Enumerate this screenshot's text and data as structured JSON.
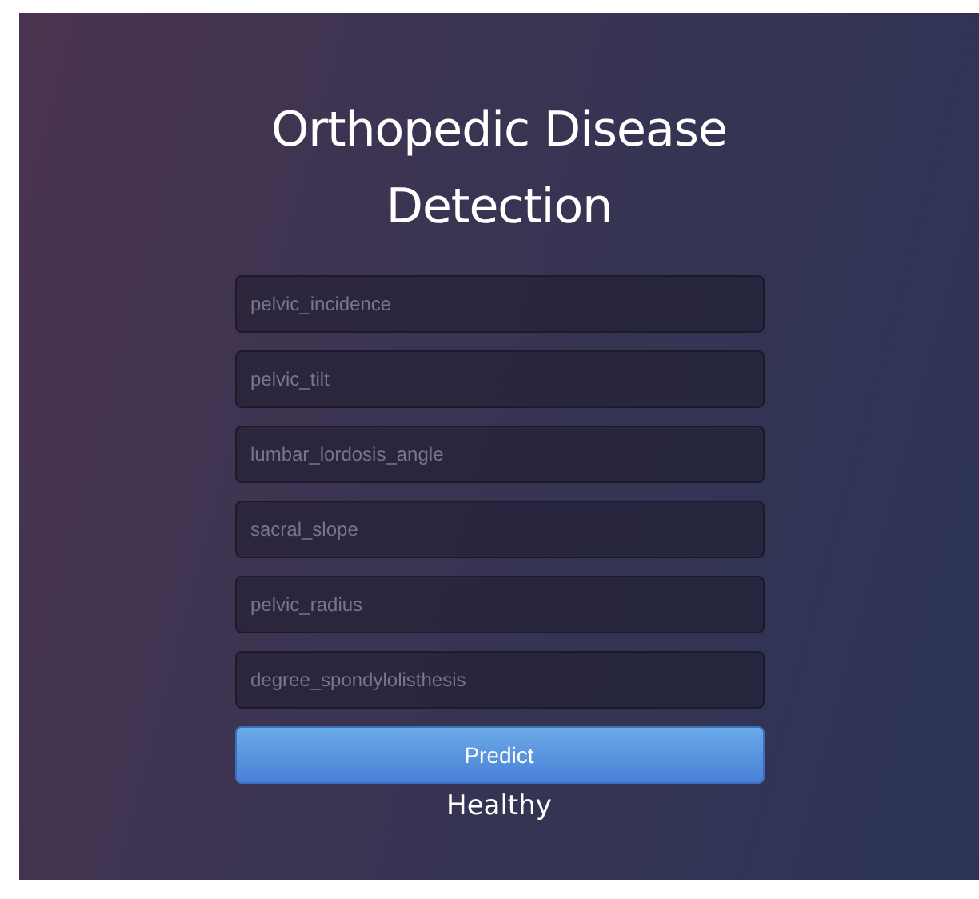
{
  "title": "Orthopedic Disease Detection",
  "fields": [
    {
      "placeholder": "pelvic_incidence"
    },
    {
      "placeholder": "pelvic_tilt"
    },
    {
      "placeholder": "lumbar_lordosis_angle"
    },
    {
      "placeholder": "sacral_slope"
    },
    {
      "placeholder": "pelvic_radius"
    },
    {
      "placeholder": "degree_spondylolisthesis"
    }
  ],
  "button": "Predict",
  "result": "Healthy"
}
